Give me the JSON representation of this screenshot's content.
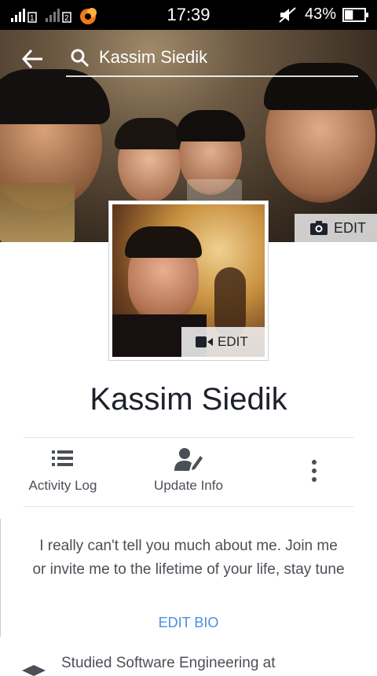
{
  "status_bar": {
    "time": "17:39",
    "battery_percent": "43%",
    "battery_level": 0.43,
    "icons": [
      "signal-sim1-icon",
      "signal-sim2-icon",
      "app-notification-icon",
      "mute-icon",
      "battery-icon"
    ]
  },
  "header": {
    "search_text": "Kassim Siedik",
    "back_icon": "arrow-left-icon",
    "search_icon": "search-icon"
  },
  "cover": {
    "edit_label": "EDIT",
    "edit_icon": "camera-icon"
  },
  "profile_picture": {
    "edit_label": "EDIT",
    "edit_icon": "video-camera-icon"
  },
  "profile": {
    "name": "Kassim Siedik"
  },
  "actions": [
    {
      "label": "Activity Log",
      "icon": "list-icon"
    },
    {
      "label": "Update Info",
      "icon": "person-edit-icon"
    },
    {
      "label": "",
      "icon": "more-vertical-icon"
    }
  ],
  "bio": {
    "text": "I really can't tell you much about me. Join me or invite me to the lifetime of your life, stay tune",
    "edit_label": "EDIT BIO"
  },
  "intro": {
    "studied_text": "Studied Software Engineering at",
    "icon": "graduation-cap-icon"
  },
  "colors": {
    "link": "#4a90e2",
    "text": "#4b4f56",
    "name": "#1d2129"
  }
}
